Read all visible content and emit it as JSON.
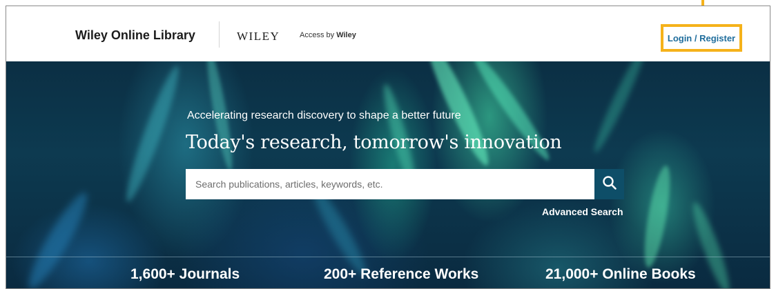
{
  "header": {
    "brand": "Wiley Online Library",
    "publisher_logo": "WILEY",
    "access_by_prefix": "Access by",
    "access_by_name": "Wiley",
    "login_label": "Login / Register"
  },
  "hero": {
    "tagline": "Accelerating research discovery to shape a better future",
    "headline": "Today's research, tomorrow's innovation",
    "search": {
      "placeholder": "Search publications, articles, keywords, etc.",
      "value": ""
    },
    "advanced_search_label": "Advanced Search"
  },
  "stats": [
    {
      "label": "1,600+ Journals"
    },
    {
      "label": "200+ Reference Works"
    },
    {
      "label": "21,000+ Online Books"
    }
  ],
  "colors": {
    "link_blue": "#1f6d9c",
    "highlight_orange": "#f5b21a",
    "search_button": "#0e4e68"
  },
  "icons": {
    "search": "search-icon"
  }
}
